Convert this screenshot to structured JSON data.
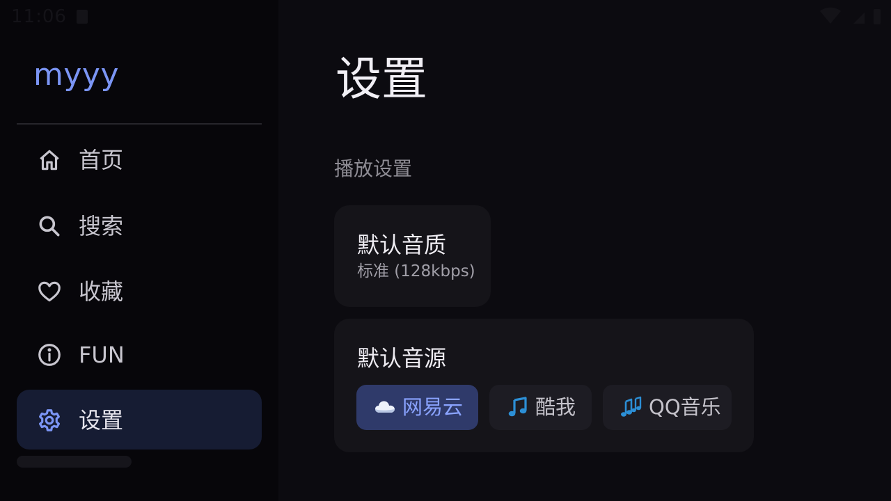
{
  "status_bar": {
    "time": "11:06"
  },
  "sidebar": {
    "brand": "myyy",
    "items": [
      {
        "label": "首页",
        "icon": "home-icon",
        "active": false
      },
      {
        "label": "搜索",
        "icon": "search-icon",
        "active": false
      },
      {
        "label": "收藏",
        "icon": "heart-icon",
        "active": false
      },
      {
        "label": "FUN",
        "icon": "info-icon",
        "active": false
      },
      {
        "label": "设置",
        "icon": "gear-icon",
        "active": true
      }
    ]
  },
  "main": {
    "title": "设置",
    "section_label": "播放设置",
    "quality_card": {
      "title": "默认音质",
      "value": "标准 (128kbps)"
    },
    "source_card": {
      "title": "默认音源",
      "options": [
        {
          "label": "网易云",
          "icon": "cloud-icon",
          "selected": true
        },
        {
          "label": "酷我",
          "icon": "music-note-icon",
          "selected": false
        },
        {
          "label": "QQ音乐",
          "icon": "music-notes-icon",
          "selected": false
        }
      ]
    }
  },
  "colors": {
    "accent": "#7b95f5",
    "active_nav_bg": "#161c33",
    "selected_chip_bg": "#2f3a6a",
    "card_bg": "#151419",
    "background": "#0c0b10"
  }
}
